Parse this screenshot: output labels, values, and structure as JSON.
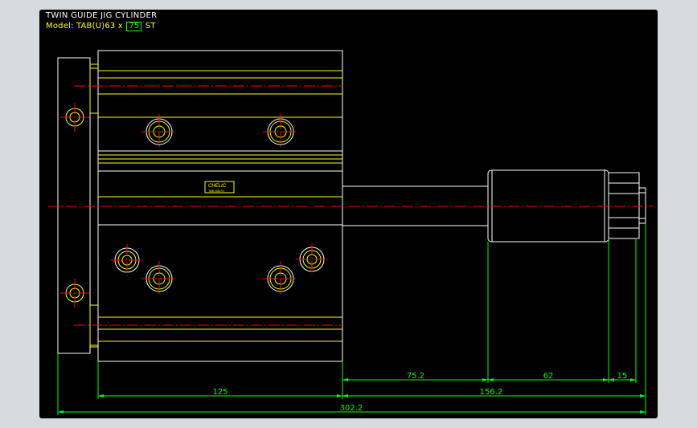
{
  "drawing": {
    "title": "TWIN GUIDE JIG CYLINDER",
    "model_prefix": "Model: TAB(U)63 x",
    "stroke": "75",
    "model_suffix": "ST",
    "nameplate_brand": "CHELIC",
    "nameplate_sub": "TAB 63x75",
    "dimensions": {
      "d1": "125",
      "d2": "75.2",
      "d3": "62",
      "d4": "15",
      "d5": "156.2",
      "d6": "302.2"
    }
  },
  "colors": {
    "background": "#000000",
    "outline_white": "#ffffff",
    "outline_yellow": "#ffff00",
    "centerline_red": "#ff0000",
    "dimension_green": "#00ff00"
  }
}
